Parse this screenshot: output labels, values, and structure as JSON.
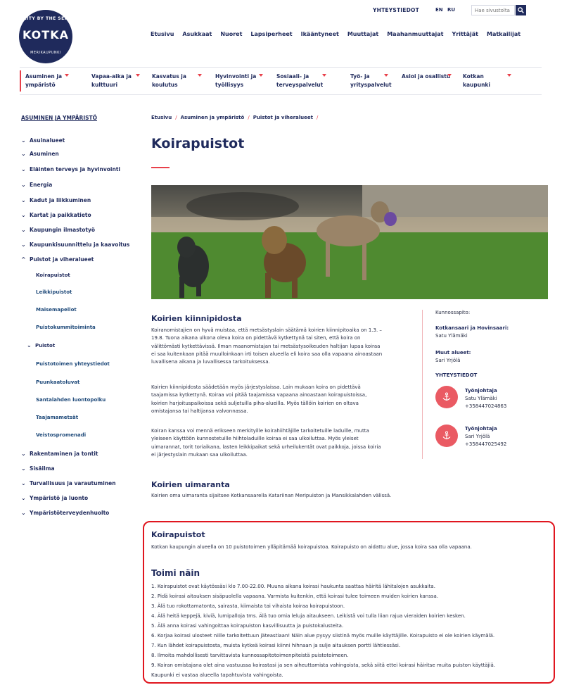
{
  "header": {
    "contact_link": "YHTEYSTIEDOT",
    "languages": [
      "EN",
      "RU"
    ],
    "search_placeholder": "Hae sivustolta",
    "logo": {
      "top": "CITY BY THE SEA",
      "main": "KOTKA",
      "bottom": "MERIKAUPUNKI"
    },
    "nav": [
      "Etusivu",
      "Asukkaat",
      "Nuoret",
      "Lapsiperheet",
      "Ikääntyneet",
      "Muuttajat",
      "Maahanmuuttajat",
      "Yrittäjät",
      "Matkailijat"
    ]
  },
  "section_nav": [
    {
      "l1": "Asuminen ja",
      "l2": "ympäristö"
    },
    {
      "l1": "Vapaa-aika ja",
      "l2": "kulttuuri"
    },
    {
      "l1": "Kasvatus ja",
      "l2": "koulutus"
    },
    {
      "l1": "Hyvinvointi ja",
      "l2": "työllisyys"
    },
    {
      "l1": "Sosiaali- ja",
      "l2": "terveyspalvelut"
    },
    {
      "l1": "Työ- ja",
      "l2": "yrityspalvelut"
    },
    {
      "l1": "Asioi ja osallistu",
      "l2": ""
    },
    {
      "l1": "Kotkan",
      "l2": "kaupunki"
    }
  ],
  "sidebar": {
    "title": "ASUMINEN JA YMPÄRISTÖ",
    "items_top": [
      "Asuinalueet",
      "Asuminen",
      "Eläinten terveys ja hyvinvointi",
      "Energia",
      "Kadut ja liikkuminen",
      "Kartat ja paikkatieto",
      "Kaupungin ilmastotyö",
      "Kaupunkisuunnittelu ja kaavoitus",
      "Puistot ja viheralueet"
    ],
    "sub_items": [
      "Koirapuistot",
      "Leikkipuistot",
      "Maisemapellot",
      "Puistokummitoiminta"
    ],
    "puistot": "Puistot",
    "sub_sub_items": [
      "Puistotoimen yhteystiedot",
      "Puunkaatoluvat",
      "Santalahden luontopolku",
      "Taajamametsät",
      "Veistospromenadi"
    ],
    "items_bottom": [
      "Rakentaminen ja tontit",
      "Sisäilma",
      "Turvallisuus ja varautuminen",
      "Ympäristö ja luonto",
      "Ympäristöterveydenhuolto"
    ]
  },
  "breadcrumb": [
    "Etusivu",
    "Asuminen ja ympäristö",
    "Puistot ja viheralueet"
  ],
  "title": "Koirapuistot",
  "article": {
    "h_leash": "Koirien kiinnipidosta",
    "p1": [
      "Koiranomistajien on hyvä muistaa, että metsästyslain säätämä koirien kiinnipitoaika on 1.3. –",
      "19.8. Tuona aikana ulkona oleva koira on pidettävä kytkettynä tai siten, että koira on",
      "välittömästi kytkettävissä. Ilman maanomistajan tai metsästysoikeuden haltijan lupaa koiraa",
      "ei saa kuitenkaan pitää muulloinkaan irti toisen alueella eli koira saa olla vapaana ainoastaan",
      "luvallisena aikana ja luvallisessa tarkoituksessa."
    ],
    "p2": [
      "Koirien kiinnipidosta säädetään myös järjestyslaissa. Lain mukaan koira on pidettävä",
      "taajamissa kytkettynä. Koiraa voi pitää taajamissa vapaana ainoastaan koirapuistoissa,",
      "koirien harjoituspaikoissa sekä suljetuilla piha-alueilla. Myös tällöin koirien on oltava",
      "omistajansa tai haltijansa valvonnassa."
    ],
    "p3": [
      "Koiran kanssa voi mennä erikseen merkityille koirahiihtäjille tarkoitetuille laduille, mutta",
      "yleiseen käyttöön kunnostetuille hiihtoladuille koiraa ei saa ulkoiluttaa. Myös yleiset",
      "uimarannat, torit toriaikana, lasten leikkipaikat sekä urheilukentät ovat paikkoja, joissa koiria",
      "ei järjestyslain mukaan saa ulkoiluttaa."
    ],
    "h_beach": "Koirien uimaranta",
    "beach": "Koirien oma uimaranta sijaitsee Kotkansaarella Katariinan Meripuiston ja Mansikkalahden välissä."
  },
  "contact": {
    "maint_label": "Kunnossapito:",
    "area1_title": "Kotkansaari ja Hovinsaari:",
    "area1_person": "Satu Ylämäki",
    "area2_title": "Muut alueet:",
    "area2_person": "Sari Yrjölä",
    "heading": "YHTEYSTIEDOT",
    "people": [
      {
        "role": "Työnjohtaja",
        "name": "Satu Ylämäki",
        "phone": "+358447024863"
      },
      {
        "role": "Työnjohtaja",
        "name": "Sari Yrjölä",
        "phone": "+358447025492"
      }
    ]
  },
  "box": {
    "h1": "Koirapuistot",
    "intro": "Kotkan kaupungin alueella on 10 puistotoimen ylläpitämää koirapuistoa. Koirapuisto on aidattu alue, jossa koira saa olla vapaana.",
    "h2": "Toimi näin",
    "rules": [
      "1. Koirapuistot ovat käytössäsi klo 7.00-22.00. Muuna aikana koirasi haukunta saattaa häiritä lähitalojen asukkaita.",
      "2. Pidä koirasi aitauksen sisäpuolella vapaana. Varmista kuitenkin, että koirasi tulee toimeen muiden koirien kanssa.",
      "3. Älä tuo rokottamatonta, sairasta, kiimaista tai vihaista koiraa koirapuistoon.",
      "4. Älä heitä keppejä, kiviä, lumipalloja tms. Älä tuo omia leluja aitaukseen. Leikistä voi tulla liian rajua vieraiden koirien kesken.",
      "5. Älä anna koirasi vahingoittaa koirapuiston kasvillisuutta ja puistokalusteita.",
      "6. Korjaa koirasi ulosteet niille tarkoitettuun jäteastiaan! Näin alue pysyy siistinä myös muille käyttäjille. Koirapuisto ei ole koirien käymälä.",
      "7. Kun lähdet koirapuistosta, muista kytkeä koirasi kiinni hihnaan ja sulje aitauksen portti lähtiessäsi.",
      "8. Ilmoita mahdollisesti tarvittavista kunnossapitotoimenpiteistä puistotoimeen.",
      "9. Koiran omistajana olet aina vastuussa koirastasi ja sen aiheuttamista vahingoista, sekä siitä ettei koirasi häiritse muita puiston käyttäjiä.",
      "Kaupunki ei vastaa alueella tapahtuvista vahingoista."
    ]
  },
  "colors": {
    "navy": "#1f2a5c",
    "accent": "#e8404a",
    "highlight_border": "#e0161f"
  }
}
